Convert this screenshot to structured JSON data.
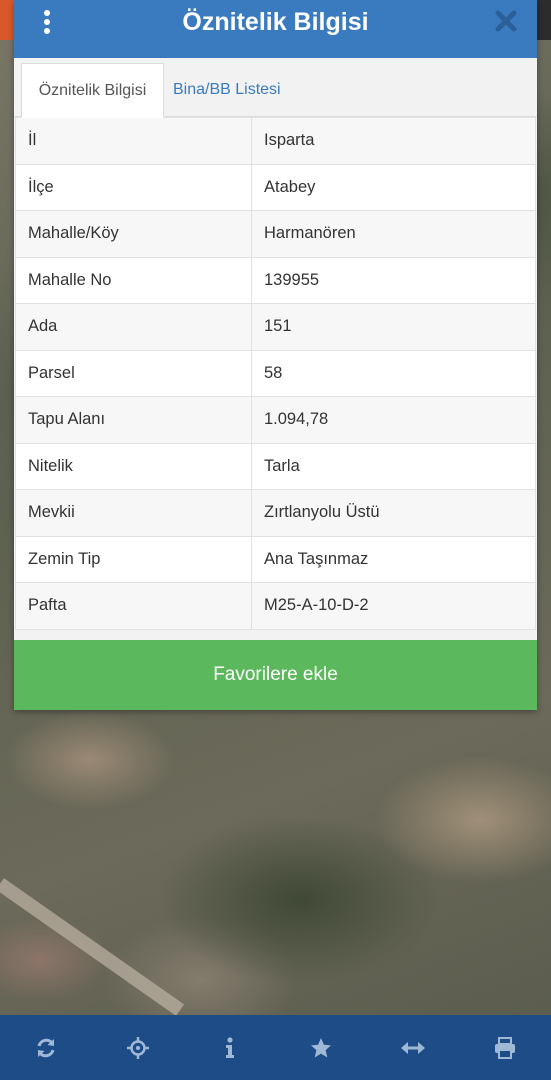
{
  "header": {
    "title": "Öznitelik Bilgisi"
  },
  "tabs": [
    {
      "label": "Öznitelik Bilgisi",
      "active": true
    },
    {
      "label": "Bina/BB Listesi",
      "active": false
    }
  ],
  "attributes": [
    {
      "key": "İl",
      "value": "Isparta"
    },
    {
      "key": "İlçe",
      "value": "Atabey"
    },
    {
      "key": "Mahalle/Köy",
      "value": "Harmanören"
    },
    {
      "key": "Mahalle No",
      "value": "139955"
    },
    {
      "key": "Ada",
      "value": "151"
    },
    {
      "key": "Parsel",
      "value": "58"
    },
    {
      "key": "Tapu Alanı",
      "value": "1.094,78"
    },
    {
      "key": "Nitelik",
      "value": "Tarla"
    },
    {
      "key": "Mevkii",
      "value": "Zırtlanyolu Üstü"
    },
    {
      "key": "Zemin Tip",
      "value": "Ana Taşınmaz"
    },
    {
      "key": "Pafta",
      "value": "M25-A-10-D-2"
    }
  ],
  "favorite_button": {
    "label": "Favorilere ekle"
  },
  "toolbar": {
    "icons": [
      "refresh-icon",
      "locate-icon",
      "info-icon",
      "star-icon",
      "measure-icon",
      "print-icon"
    ]
  },
  "colors": {
    "header": "#3a7bbf",
    "favorite": "#5cb85c",
    "toolbar": "#1e4c87",
    "tab_link": "#3a7bbf"
  }
}
